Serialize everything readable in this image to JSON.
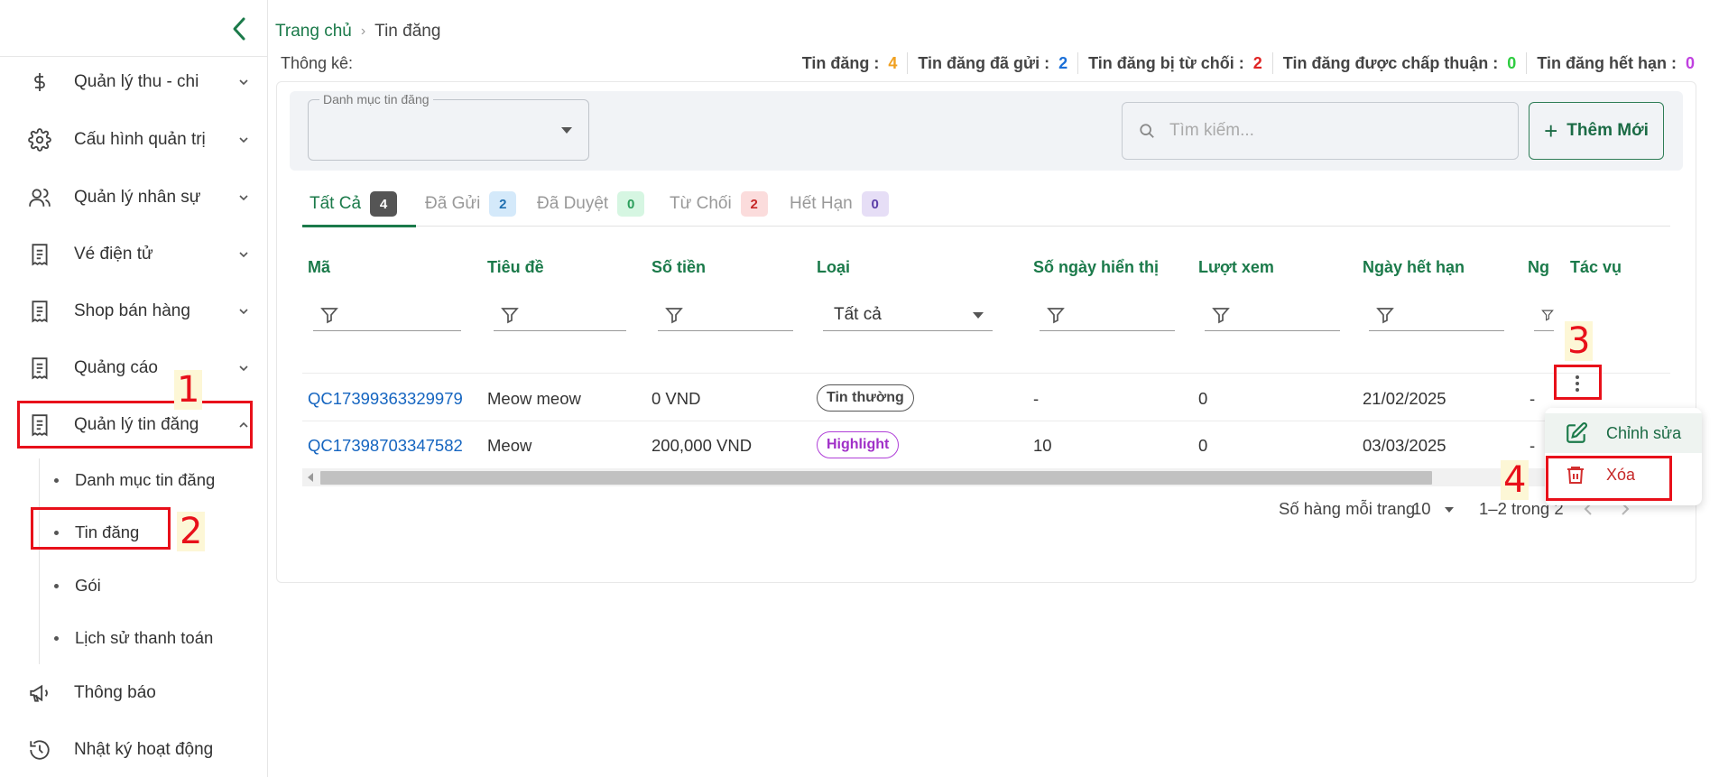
{
  "sidebar": {
    "items": [
      {
        "label": "Quản lý thu - chi",
        "icon": "dollar-icon"
      },
      {
        "label": "Cấu hình quản trị",
        "icon": "gear-icon"
      },
      {
        "label": "Quản lý nhân sự",
        "icon": "users-icon"
      },
      {
        "label": "Vé điện tử",
        "icon": "receipt-icon"
      },
      {
        "label": "Shop bán hàng",
        "icon": "receipt-icon"
      },
      {
        "label": "Quảng cáo",
        "icon": "receipt-icon"
      },
      {
        "label": "Quản lý tin đăng",
        "icon": "receipt-icon",
        "expanded": true
      },
      {
        "label": "Thông báo",
        "icon": "megaphone-icon"
      },
      {
        "label": "Nhật ký hoạt động",
        "icon": "history-icon"
      }
    ],
    "subitems": [
      "Danh mục tin đăng",
      "Tin đăng",
      "Gói",
      "Lịch sử thanh toán"
    ]
  },
  "annotations": [
    "1",
    "2",
    "3",
    "4"
  ],
  "breadcrumb": {
    "home": "Trang chủ",
    "separator": "›",
    "current": "Tin đăng"
  },
  "stats": {
    "label": "Thông kê:",
    "items": [
      {
        "label": "Tin đăng :",
        "value": "4",
        "color": "#f0a020"
      },
      {
        "label": "Tin đăng đã gửi :",
        "value": "2",
        "color": "#1a6fd8"
      },
      {
        "label": "Tin đăng bị từ chối :",
        "value": "2",
        "color": "#e02424"
      },
      {
        "label": "Tin đăng được chấp thuận :",
        "value": "0",
        "color": "#2ecc40"
      },
      {
        "label": "Tin đăng hết hạn :",
        "value": "0",
        "color": "#c040e0"
      }
    ]
  },
  "filters": {
    "category_label": "Danh mục tin đăng",
    "category_value": "",
    "search_placeholder": "Tìm kiếm...",
    "add_button": "Thêm Mới"
  },
  "tabs": [
    {
      "label": "Tất Cả",
      "count": "4",
      "active": true,
      "badge_bg": "#555555",
      "badge_fg": "#ffffff"
    },
    {
      "label": "Đã Gửi",
      "count": "2",
      "badge_bg": "#d4e9fa",
      "badge_fg": "#1f6fb0"
    },
    {
      "label": "Đã Duyệt",
      "count": "0",
      "badge_bg": "#d6f6e2",
      "badge_fg": "#2a9d5a"
    },
    {
      "label": "Từ Chối",
      "count": "2",
      "badge_bg": "#fbdcdc",
      "badge_fg": "#c62828"
    },
    {
      "label": "Hết Hạn",
      "count": "0",
      "badge_bg": "#e6def6",
      "badge_fg": "#5b3ea8"
    }
  ],
  "table": {
    "columns": [
      "Mã",
      "Tiêu đề",
      "Số tiền",
      "Loại",
      "Số ngày hiển thị",
      "Lượt xem",
      "Ngày hết hạn",
      "Ng",
      "Tác vụ"
    ],
    "type_filter_value": "Tất cả",
    "rows": [
      {
        "code": "QC17399363329979",
        "title": "Meow meow",
        "amount": "0 VND",
        "type": "Tin thường",
        "type_style": "normal",
        "days": "-",
        "views": "0",
        "expiry": "21/02/2025",
        "extra": "-"
      },
      {
        "code": "QC17398703347582",
        "title": "Meow",
        "amount": "200,000 VND",
        "type": "Highlight",
        "type_style": "highlight",
        "days": "10",
        "views": "0",
        "expiry": "03/03/2025",
        "extra": "-"
      }
    ]
  },
  "pagination": {
    "rows_label": "Số hàng mỗi trang:",
    "rows_value": "10",
    "range": "1–2 trong 2"
  },
  "action_menu": {
    "edit": "Chỉnh sửa",
    "delete": "Xóa"
  },
  "colors": {
    "primary": "#1b7a4a",
    "link": "#1565c0",
    "annotation": "#e8101a"
  }
}
